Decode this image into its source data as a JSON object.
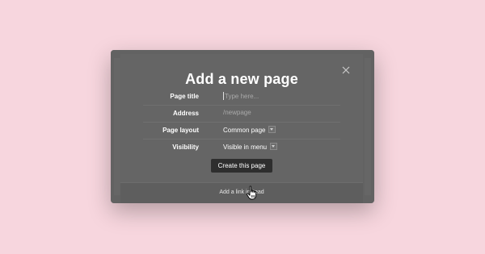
{
  "dialog": {
    "title": "Add a new page",
    "fields": {
      "page_title": {
        "label": "Page title",
        "value": "",
        "placeholder": "Type here..."
      },
      "address": {
        "label": "Address",
        "value": "/newpage"
      },
      "page_layout": {
        "label": "Page layout",
        "value": "Common page"
      },
      "visibility": {
        "label": "Visibility",
        "value": "Visible in menu"
      }
    },
    "create_button": "Create this page",
    "add_link": "Add a link instead",
    "close_icon": "close-icon"
  },
  "colors": {
    "background": "#f7d6de",
    "dialog": "#656565",
    "button": "#2e2e2e"
  }
}
